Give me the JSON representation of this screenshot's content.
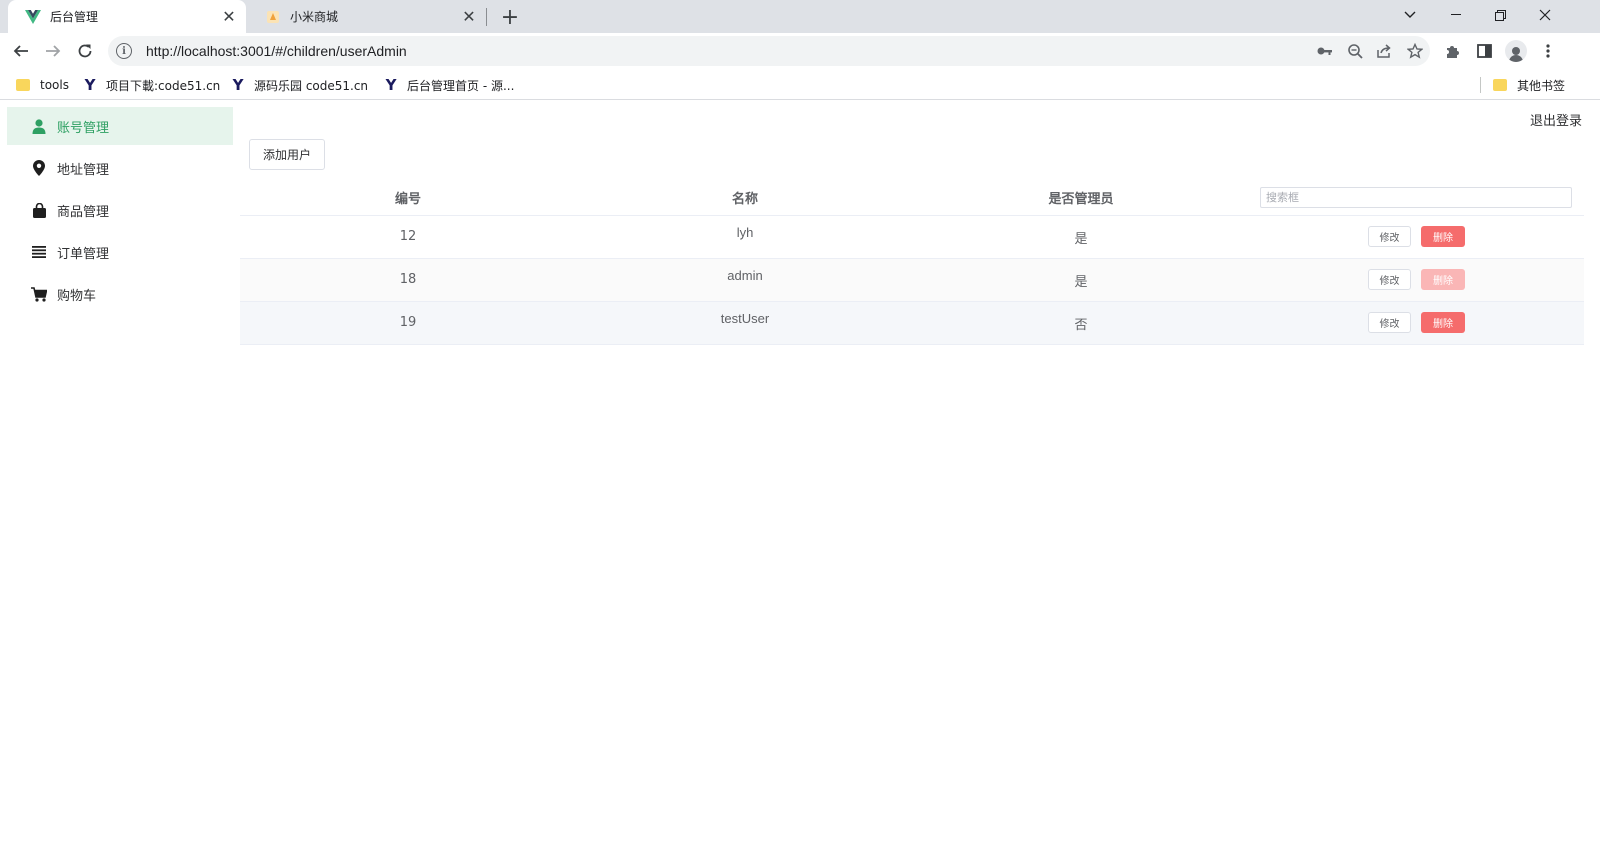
{
  "browser": {
    "tabs": [
      {
        "title": "后台管理",
        "active": true,
        "favicon": "vue-logo-icon"
      },
      {
        "title": "小米商城",
        "active": false,
        "favicon": "mi-logo-icon"
      }
    ],
    "url": "http://localhost:3001/#/children/userAdmin",
    "bookmarks": [
      {
        "label": "tools",
        "icon": "folder-icon"
      },
      {
        "label": "项目下載:code51.cn",
        "icon": "y-logo-icon"
      },
      {
        "label": "源码乐园 code51.cn",
        "icon": "y-logo-icon"
      },
      {
        "label": "后台管理首页 - 源...",
        "icon": "y-logo-icon"
      }
    ],
    "other_bookmarks": "其他书签"
  },
  "sidebar": {
    "items": [
      {
        "label": "账号管理",
        "icon": "user-icon",
        "active": true
      },
      {
        "label": "地址管理",
        "icon": "location-pin-icon",
        "active": false
      },
      {
        "label": "商品管理",
        "icon": "shopping-bag-icon",
        "active": false
      },
      {
        "label": "订单管理",
        "icon": "list-icon",
        "active": false
      },
      {
        "label": "购物车",
        "icon": "cart-icon",
        "active": false
      }
    ]
  },
  "header": {
    "logout": "退出登录"
  },
  "actions": {
    "add_user": "添加用户"
  },
  "table": {
    "headers": {
      "id": "编号",
      "name": "名称",
      "is_admin": "是否管理员"
    },
    "search_placeholder": "搜索框",
    "rows": [
      {
        "id": "12",
        "name": "lyh",
        "is_admin": "是",
        "edit": "修改",
        "delete": "删除",
        "delete_disabled": false
      },
      {
        "id": "18",
        "name": "admin",
        "is_admin": "是",
        "edit": "修改",
        "delete": "删除",
        "delete_disabled": true
      },
      {
        "id": "19",
        "name": "testUser",
        "is_admin": "否",
        "edit": "修改",
        "delete": "删除",
        "delete_disabled": false
      }
    ]
  },
  "colors": {
    "accent": "#2ea063",
    "danger": "#f56c6c",
    "danger_disabled": "#fab6b6"
  }
}
